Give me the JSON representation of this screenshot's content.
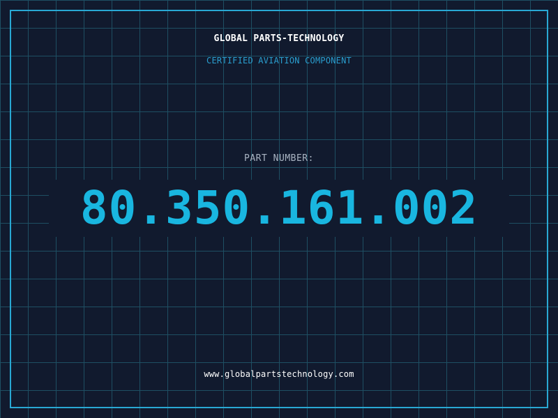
{
  "header": {
    "company": "GLOBAL PARTS-TECHNOLOGY",
    "subtitle": "CERTIFIED AVIATION COMPONENT"
  },
  "part": {
    "label": "PART NUMBER:",
    "number": "80.350.161.002"
  },
  "footer": {
    "website": "www.globalpartstechnology.com"
  },
  "colors": {
    "background": "#111a2e",
    "grid": "#1e4f63",
    "accent": "#19b6e0",
    "frame": "#29a8d4",
    "text": "#ffffff",
    "muted": "#a9b4c2"
  }
}
